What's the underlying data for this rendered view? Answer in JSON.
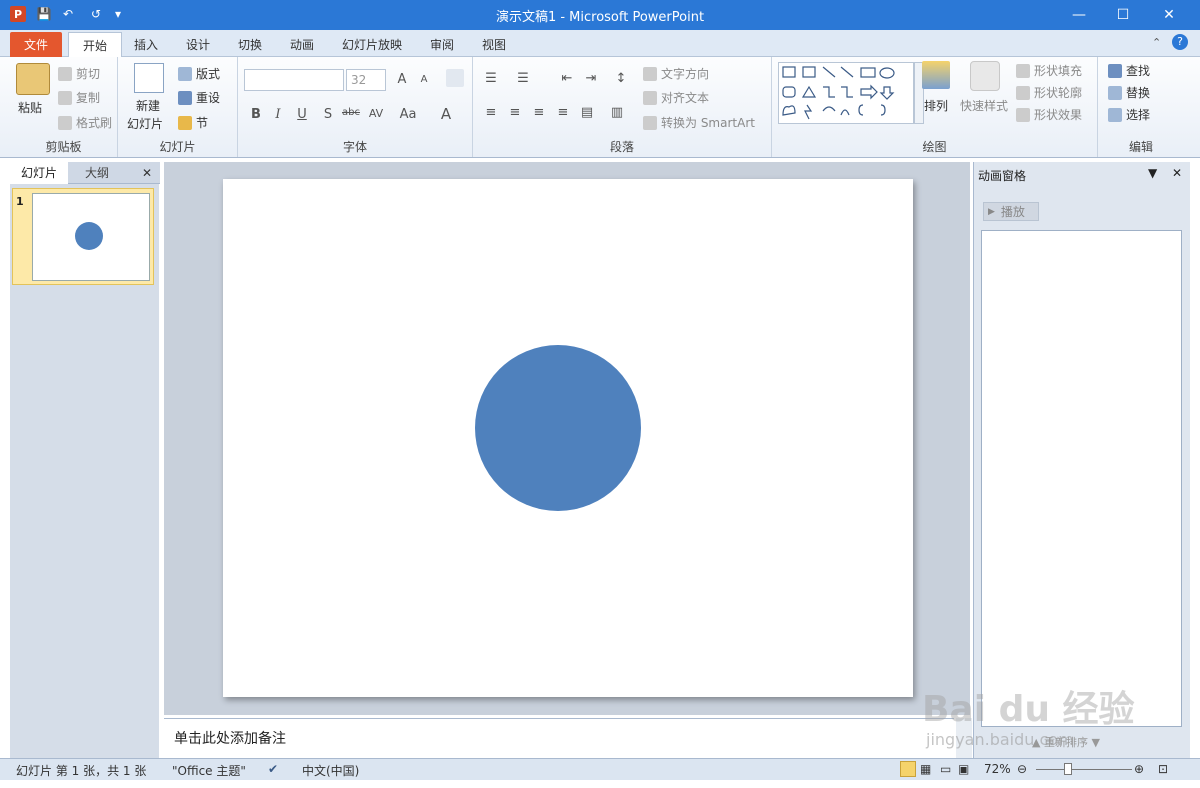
{
  "window": {
    "title": "演示文稿1 - Microsoft PowerPoint",
    "minimize": "—",
    "maximize": "☐",
    "close": "✕"
  },
  "quick_access": {
    "app_icon": "P",
    "save": "💾",
    "undo": "↶",
    "redo": "↺",
    "more": "▾"
  },
  "tabs": [
    "文件",
    "开始",
    "插入",
    "设计",
    "切换",
    "动画",
    "幻灯片放映",
    "审阅",
    "视图"
  ],
  "ribbon": {
    "clipboard": {
      "label": "剪贴板",
      "paste": "粘贴",
      "cut": "剪切",
      "copy": "复制",
      "format_painter": "格式刷"
    },
    "slides": {
      "label": "幻灯片",
      "new_slide_1": "新建",
      "new_slide_2": "幻灯片",
      "layout": "版式",
      "reset": "重设",
      "section": "节"
    },
    "font": {
      "label": "字体",
      "size": "32",
      "bold": "B",
      "italic": "I",
      "underline": "U",
      "shadow": "S",
      "strike": "abc",
      "spacing": "AV",
      "case": "Aa",
      "color": "A",
      "grow": "A",
      "shrink": "A"
    },
    "paragraph": {
      "label": "段落",
      "text_direction": "文字方向",
      "align_text": "对齐文本",
      "smartart": "转换为 SmartArt"
    },
    "drawing": {
      "label": "绘图",
      "arrange": "排列",
      "quick_styles": "快速样式",
      "fill": "形状填充",
      "outline": "形状轮廓",
      "effects": "形状效果"
    },
    "editing": {
      "label": "编辑",
      "find": "查找",
      "replace": "替换",
      "select": "选择"
    }
  },
  "left_panel": {
    "tab_slides": "幻灯片",
    "tab_outline": "大纲",
    "close": "✕",
    "slide_number": "1"
  },
  "notes": {
    "placeholder": "单击此处添加备注"
  },
  "animation_pane": {
    "title": "动画窗格",
    "play": "播放",
    "reorder": "重新排序"
  },
  "status": {
    "slide_info": "幻灯片 第 1 张，共 1 张",
    "theme": "\"Office 主题\"",
    "language": "中文(中国)",
    "zoom": "72%"
  },
  "watermark": {
    "brand": "Bai du 经验",
    "url": "jingyan.baidu.com"
  },
  "colors": {
    "accent": "#2b78d6",
    "shape_fill": "#4f81bd",
    "file_tab": "#e4572e"
  }
}
